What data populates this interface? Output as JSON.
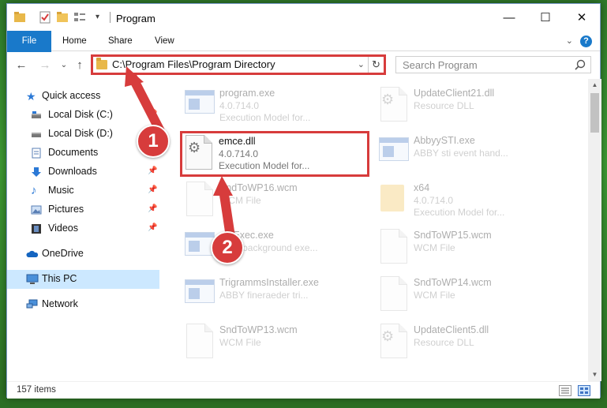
{
  "window": {
    "title": "Program",
    "minimize": "—",
    "maximize": "☐",
    "close": "✕"
  },
  "ribbon": {
    "tabs": [
      "File",
      "Home",
      "Share",
      "View"
    ],
    "expand": "⌄",
    "help": "?"
  },
  "nav": {
    "back": "←",
    "forward": "→",
    "recent": "⌄",
    "up": "↑",
    "address": "C:\\Program Files\\Program Directory",
    "dropdown": "⌄",
    "refresh": "↻",
    "search_placeholder": "Search Program"
  },
  "sidebar": {
    "items": [
      {
        "label": "Quick access",
        "icon": "star-icon"
      },
      {
        "label": "Local Disk (C:)",
        "icon": "drive-icon",
        "pinned": true
      },
      {
        "label": "Local Disk (D:)",
        "icon": "drive-icon",
        "pinned": true
      },
      {
        "label": "Documents",
        "icon": "documents-icon",
        "pinned": true
      },
      {
        "label": "Downloads",
        "icon": "download-icon",
        "pinned": true
      },
      {
        "label": "Music",
        "icon": "music-icon",
        "pinned": true
      },
      {
        "label": "Pictures",
        "icon": "pictures-icon",
        "pinned": true
      },
      {
        "label": "Videos",
        "icon": "videos-icon",
        "pinned": true
      },
      {
        "label": "OneDrive",
        "icon": "cloud-icon"
      },
      {
        "label": "This PC",
        "icon": "pc-icon",
        "selected": true
      },
      {
        "label": "Network",
        "icon": "network-icon"
      }
    ],
    "pin_glyph": "📌"
  },
  "files": [
    {
      "name": "program.exe",
      "line2": "4.0.714.0",
      "line3": "Execution Model for...",
      "icon": "app"
    },
    {
      "name": "UpdateClient21.dll",
      "line2": "Resource DLL",
      "line3": "",
      "icon": "dll"
    },
    {
      "name": "emce.dll",
      "line2": "4.0.714.0",
      "line3": "Execution Model for...",
      "icon": "dll",
      "highlighted": true
    },
    {
      "name": "AbbyySTI.exe",
      "line2": "ABBY sti event hand...",
      "line3": "",
      "icon": "app"
    },
    {
      "name": "SndToWP16.wcm",
      "line2": "WCM File",
      "line3": "",
      "icon": "page"
    },
    {
      "name": "x64",
      "line2": "4.0.714.0",
      "line3": "Execution Model for...",
      "icon": "folder"
    },
    {
      "name": "...eExec.exe",
      "line2": "...BY background exe...",
      "line3": "",
      "icon": "app"
    },
    {
      "name": "SndToWP15.wcm",
      "line2": "WCM File",
      "line3": "",
      "icon": "page"
    },
    {
      "name": "TrigrammsInstaller.exe",
      "line2": "ABBY fineraeder tri...",
      "line3": "",
      "icon": "app"
    },
    {
      "name": "SndToWP14.wcm",
      "line2": "WCM File",
      "line3": "",
      "icon": "page"
    },
    {
      "name": "SndToWP13.wcm",
      "line2": "WCM File",
      "line3": "",
      "icon": "page"
    },
    {
      "name": "UpdateClient5.dll",
      "line2": "Resource DLL",
      "line3": "",
      "icon": "dll"
    }
  ],
  "status": {
    "items": "157 items"
  },
  "annotations": {
    "step1": "1",
    "step2": "2",
    "color": "#d73c3c"
  },
  "colors": {
    "accent": "#1979ca",
    "highlight_box": "#d73c3c",
    "selected_nav": "#cce8ff"
  }
}
